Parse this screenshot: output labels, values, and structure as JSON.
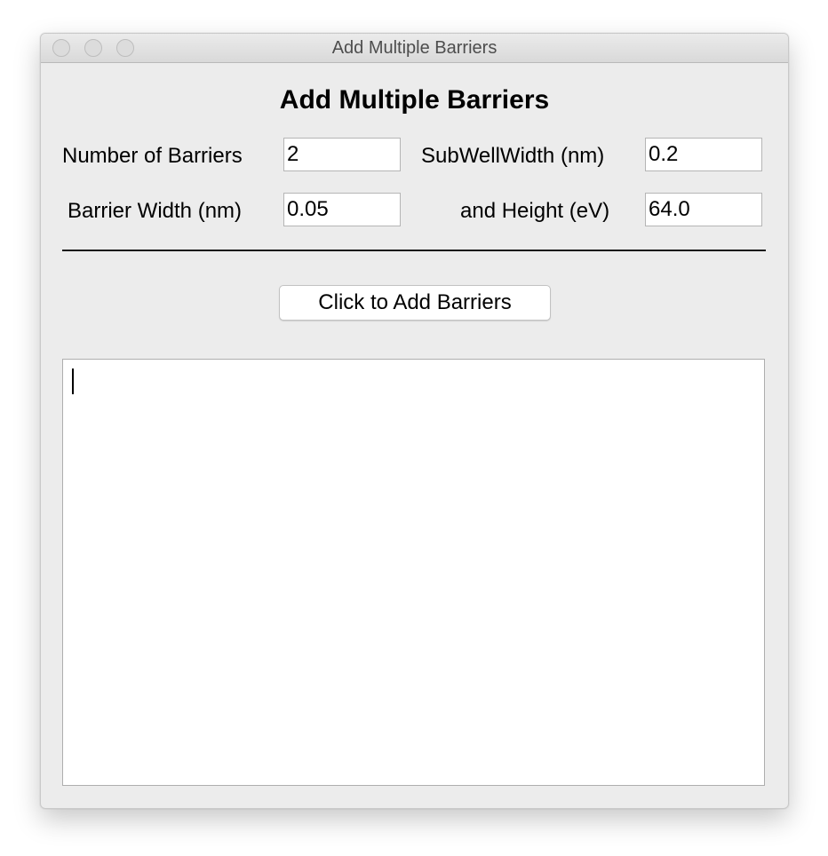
{
  "window": {
    "title": "Add Multiple Barriers"
  },
  "form": {
    "heading": "Add Multiple Barriers",
    "number_of_barriers": {
      "label": "Number of Barriers",
      "value": "2"
    },
    "subwell_width": {
      "label": "SubWellWidth (nm)",
      "value": "0.2"
    },
    "barrier_width": {
      "label": "Barrier Width (nm)",
      "value": "0.05"
    },
    "barrier_height": {
      "label": "and Height (eV)",
      "value": "64.0"
    },
    "add_button_label": "Click to Add Barriers"
  },
  "output": {
    "text": ""
  },
  "colors": {
    "window_bg": "#ececec",
    "field_bg": "#ffffff",
    "text": "#000000"
  }
}
